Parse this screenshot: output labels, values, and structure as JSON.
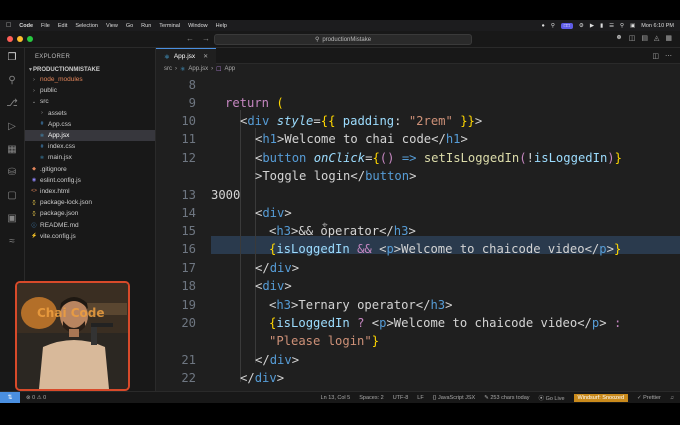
{
  "menubar": {
    "app": "Code",
    "items": [
      "File",
      "Edit",
      "Selection",
      "View",
      "Go",
      "Run",
      "Terminal",
      "Window",
      "Help"
    ],
    "clock": "Mon 6:10 PM"
  },
  "titlebar": {
    "search_text": "productionMistake"
  },
  "sidebar": {
    "header": "EXPLORER",
    "project": "PRODUCTIONMISTAKE",
    "items": [
      {
        "label": "node_modules",
        "kind": "folder-collapsed",
        "depth": 1,
        "color": "#e2855a"
      },
      {
        "label": "public",
        "kind": "folder-collapsed",
        "depth": 1,
        "color": "#cccccc"
      },
      {
        "label": "src",
        "kind": "folder-open",
        "depth": 1,
        "color": "#cccccc"
      },
      {
        "label": "assets",
        "kind": "folder-collapsed",
        "depth": 2,
        "color": "#cccccc"
      },
      {
        "label": "App.css",
        "kind": "css",
        "depth": 2,
        "color": "#cccccc"
      },
      {
        "label": "App.jsx",
        "kind": "jsx",
        "depth": 2,
        "color": "#ffffff",
        "active": true
      },
      {
        "label": "index.css",
        "kind": "css",
        "depth": 2,
        "color": "#cccccc"
      },
      {
        "label": "main.jsx",
        "kind": "jsx",
        "depth": 2,
        "color": "#cccccc"
      },
      {
        "label": ".gitignore",
        "kind": "git",
        "depth": 1,
        "color": "#cccccc"
      },
      {
        "label": "eslint.config.js",
        "kind": "eslint",
        "depth": 1,
        "color": "#cccccc"
      },
      {
        "label": "index.html",
        "kind": "html",
        "depth": 1,
        "color": "#cccccc"
      },
      {
        "label": "package-lock.json",
        "kind": "json",
        "depth": 1,
        "color": "#cccccc"
      },
      {
        "label": "package.json",
        "kind": "json",
        "depth": 1,
        "color": "#cccccc"
      },
      {
        "label": "README.md",
        "kind": "md",
        "depth": 1,
        "color": "#cccccc"
      },
      {
        "label": "vite.config.js",
        "kind": "js",
        "depth": 1,
        "color": "#cccccc"
      }
    ]
  },
  "editor": {
    "tab_label": "App.jsx",
    "breadcrumb": [
      "src",
      "App.jsx",
      "App"
    ],
    "line_numbers": [
      "8",
      "9",
      "10",
      "11",
      "12",
      "",
      "13",
      "14",
      "15",
      "16",
      "17",
      "18",
      "19",
      "20",
      "",
      "21",
      "22"
    ],
    "typed_text": "3000"
  },
  "status": {
    "position": "Ln 13, Col 5",
    "spaces": "Spaces: 2",
    "encoding": "UTF-8",
    "eol": "LF",
    "language": "JavaScript JSX",
    "chars": "253 chars today",
    "golive": "Go Live",
    "windsurf": "Windsurf: Snoozed",
    "prettier": "Prettier"
  },
  "webcam": {
    "sign_text": "Chai Code"
  }
}
